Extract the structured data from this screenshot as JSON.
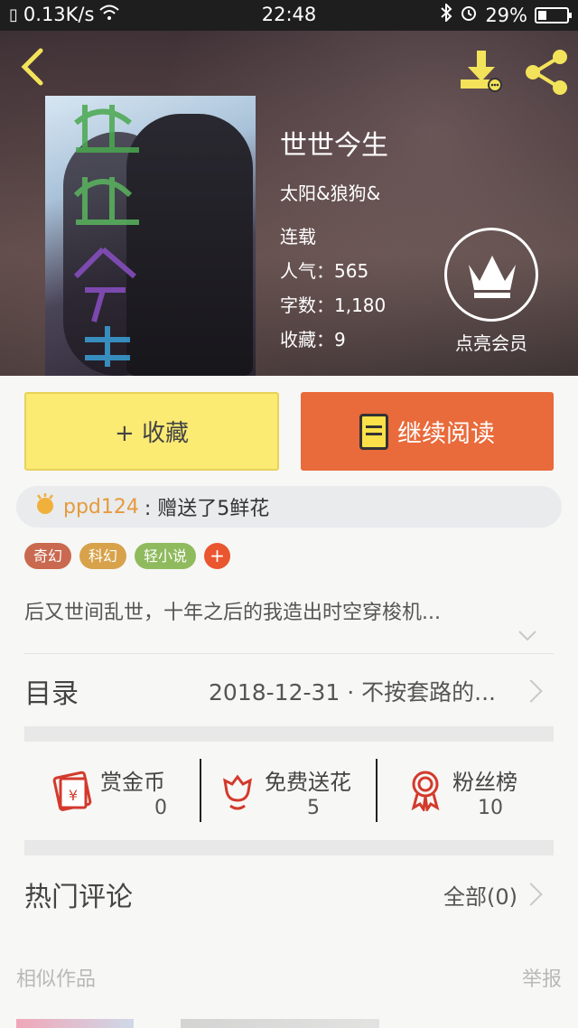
{
  "status_bar": {
    "speed": "0.13K/s",
    "time": "22:48",
    "battery": "29%",
    "battery_level": 0.29,
    "icons": [
      "sim-icon",
      "wifi-icon",
      "bluetooth-icon",
      "alarm-icon",
      "battery-icon"
    ]
  },
  "header": {
    "icons": [
      "back-icon",
      "download-icon",
      "share-icon"
    ],
    "accent_color": "#f3e35a"
  },
  "book": {
    "title": "世世今生",
    "author": "太阳&狼狗&",
    "status": "连载",
    "popularity": "人气：565",
    "word_count": "字数：1,180",
    "favorites": "收藏：9"
  },
  "vip": {
    "label": "点亮会员",
    "icon": "crown-icon"
  },
  "actions": {
    "collect_label": "+ 收藏",
    "read_label": "继续阅读",
    "collect_color": "#fbeb73",
    "read_color": "#e96a3a"
  },
  "gift": {
    "user": "ppd124",
    "text": ": 赠送了5鲜花",
    "icon": "flower-clap-icon"
  },
  "tags": [
    {
      "label": "奇幻",
      "color": "#c9694f"
    },
    {
      "label": "科幻",
      "color": "#d8a24a"
    },
    {
      "label": "轻小说",
      "color": "#8fba5e"
    }
  ],
  "tag_add_label": "+",
  "description": "后又世间乱世，十年之后的我造出时空穿梭机...",
  "toc": {
    "label": "目录",
    "latest": "2018-12-31 · 不按套路的..."
  },
  "stats": [
    {
      "label": "赏金币",
      "value": "0",
      "icon": "red-envelope-icon"
    },
    {
      "label": "免费送花",
      "value": "5",
      "icon": "flower-icon"
    },
    {
      "label": "粉丝榜",
      "value": "10",
      "icon": "medal-icon"
    }
  ],
  "comments": {
    "label": "热门评论",
    "all_label": "全部(0)"
  },
  "footer": {
    "similar_label": "相似作品",
    "report_label": "举报"
  }
}
